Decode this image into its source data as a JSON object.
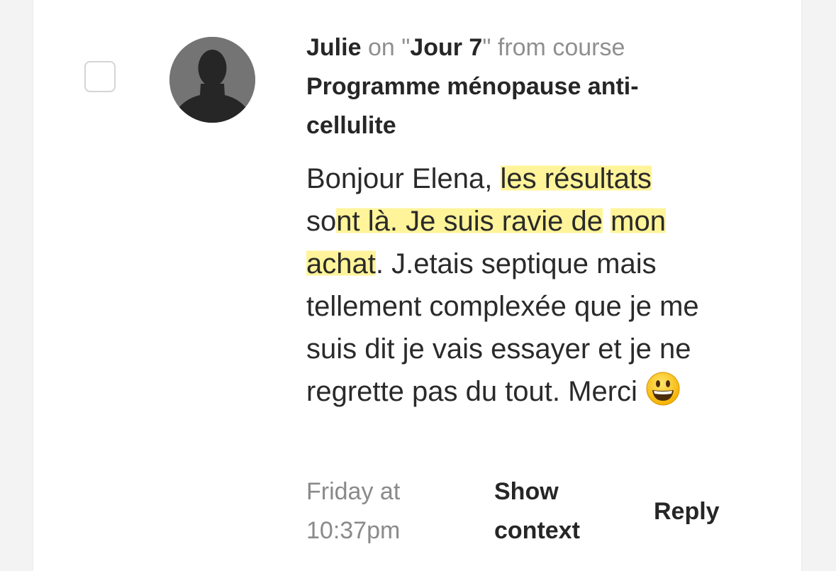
{
  "comment": {
    "author": "Julie",
    "on_word": "on",
    "quote_open": "\"",
    "lesson": "Jour 7",
    "quote_close": "\"",
    "from_course_text": "from course",
    "course_line1": "Programme ménopause anti-",
    "course_line2": "cellulite",
    "body_part1": "Bonjour Elena, ",
    "body_highlight1": "les résultats",
    "body_part2": " so",
    "body_highlight2": "nt là. Je suis ravie de",
    "body_part3": " ",
    "body_highlight3": "mon achat",
    "body_part4": ". J.etais septique mais tellement complexée que je me suis dit je vais essayer et je ne regrette pas du tout. Merci",
    "emoji_icon": "grinning-face-emoji",
    "timestamp_line1": "Friday at",
    "timestamp_line2": "10:37pm",
    "show_context_line1": "Show",
    "show_context_line2": "context",
    "reply_label": "Reply"
  },
  "colors": {
    "highlight": "#fff078",
    "avatar_bg": "#747474",
    "avatar_silhouette": "#262626",
    "muted_text": "#8f8f8f",
    "strong_text": "#262626"
  }
}
